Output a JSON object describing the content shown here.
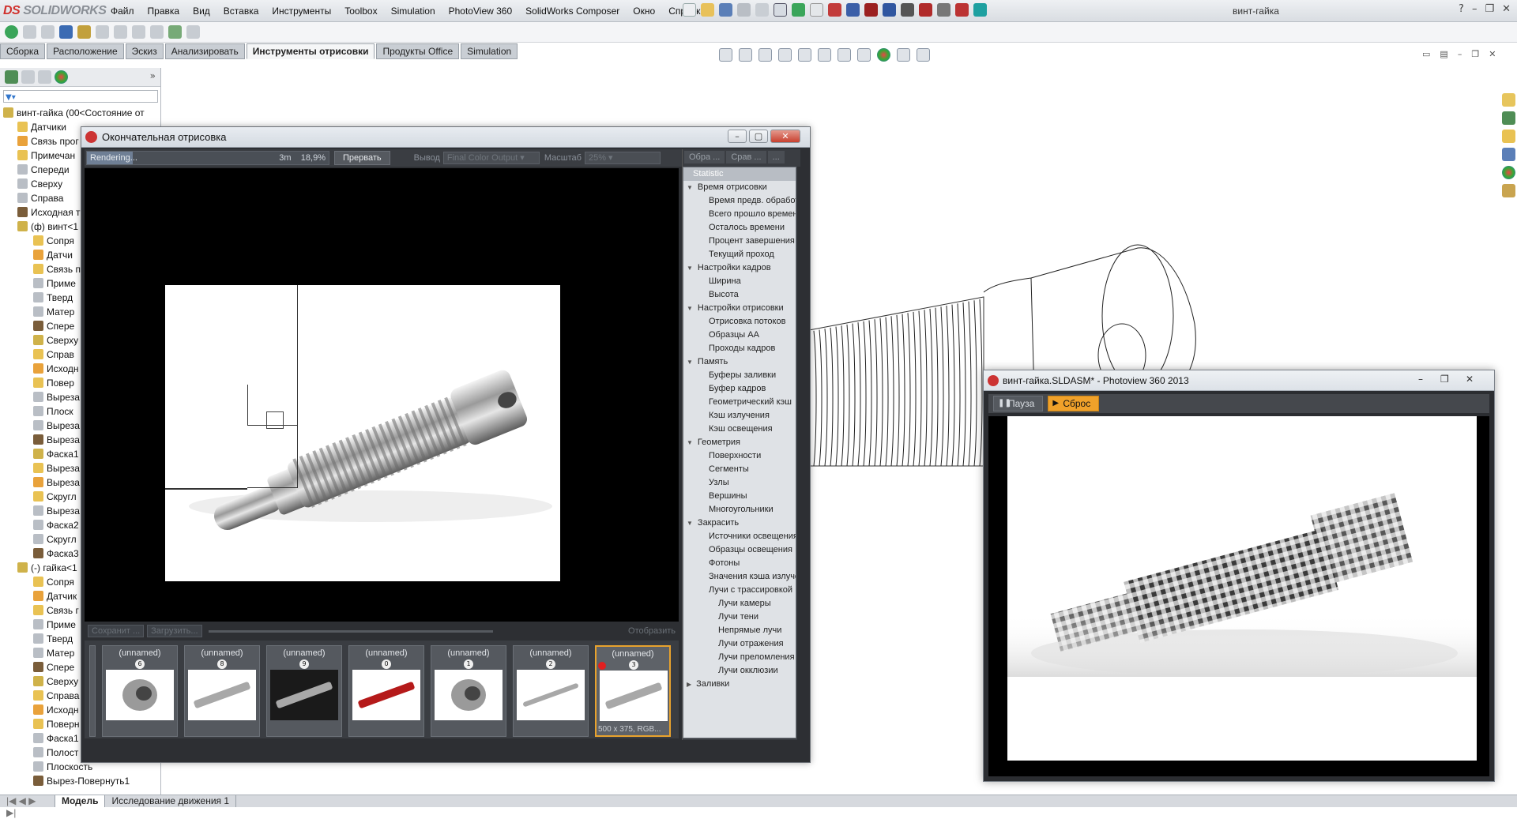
{
  "app": {
    "brand": "SOLIDWORKS",
    "brand_prefix": "DS",
    "title": "винт-гайка"
  },
  "menu": [
    "Файл",
    "Правка",
    "Вид",
    "Вставка",
    "Инструменты",
    "Toolbox",
    "Simulation",
    "PhotoView 360",
    "SolidWorks Composer",
    "Окно",
    "Справка"
  ],
  "command_tabs": [
    {
      "label": "Сборка",
      "active": false
    },
    {
      "label": "Расположение",
      "active": false
    },
    {
      "label": "Эскиз",
      "active": false
    },
    {
      "label": "Анализировать",
      "active": false
    },
    {
      "label": "Инструменты отрисовки",
      "active": true
    },
    {
      "label": "Продукты Office",
      "active": false
    },
    {
      "label": "Simulation",
      "active": false
    }
  ],
  "tree": {
    "root": "винт-гайка  (00<Состояние от",
    "items": [
      "Датчики",
      "Связь прог",
      "Примечан",
      "Спереди",
      "Сверху",
      "Справа",
      "Исходная т",
      "(ф) винт<1",
      "Сопря",
      "Датчи",
      "Связь п",
      "Приме",
      "Тверд",
      "Матер",
      "Спере",
      "Сверху",
      "Справ",
      "Исходн",
      "Повер",
      "Выреза",
      "Плоск",
      "Выреза",
      "Выреза",
      "Фаска1",
      "Выреза",
      "Выреза",
      "Скругл",
      "Выреза",
      "Фаска2",
      "Скругл",
      "Фаска3",
      "(-) гайка<1",
      "Сопря",
      "Датчик",
      "Связь г",
      "Приме",
      "Тверд",
      "Матер",
      "Спере",
      "Сверху",
      "Справа",
      "Исходн",
      "Поверн",
      "Фаска1",
      "Полост",
      "Плоскость",
      "Вырез-Повернуть1"
    ]
  },
  "bottom_tabs": [
    {
      "label": "Модель",
      "active": true
    },
    {
      "label": "Исследование движения 1",
      "active": false
    }
  ],
  "render_window": {
    "title": "Окончательная отрисовка",
    "status": "Rendering...",
    "time_left": "3m",
    "percent_text": "18,9%",
    "progress": 0.189,
    "abort_label": "Прервать",
    "output_label": "Вывод",
    "output_value": "Final Color Output",
    "scale_label": "Масштаб",
    "scale_value": "25%",
    "save_label": "Сохранит ...",
    "load_label": "Загрузить...",
    "show_label": "Отобразить",
    "stat_tabs": [
      "Обра ...",
      "Срав ...",
      "..."
    ],
    "stat_header": "Statistic",
    "stats": [
      {
        "t": "Время отрисовки",
        "k": "g"
      },
      {
        "t": "Время предв. обработки",
        "k": "i"
      },
      {
        "t": "Всего прошло времени",
        "k": "i"
      },
      {
        "t": "Осталось времени",
        "k": "i"
      },
      {
        "t": "Процент завершения",
        "k": "i"
      },
      {
        "t": "Текущий проход",
        "k": "i"
      },
      {
        "t": "Настройки кадров",
        "k": "g"
      },
      {
        "t": "Ширина",
        "k": "i"
      },
      {
        "t": "Высота",
        "k": "i"
      },
      {
        "t": "Настройки отрисовки",
        "k": "g"
      },
      {
        "t": "Отрисовка потоков",
        "k": "i"
      },
      {
        "t": "Образцы AA",
        "k": "i"
      },
      {
        "t": "Проходы кадров",
        "k": "i"
      },
      {
        "t": "Память",
        "k": "g"
      },
      {
        "t": "Буферы заливки",
        "k": "i"
      },
      {
        "t": "Буфер кадров",
        "k": "i"
      },
      {
        "t": "Геометрический кэш",
        "k": "i"
      },
      {
        "t": "Кэш излучения",
        "k": "i"
      },
      {
        "t": "Кэш освещения",
        "k": "i"
      },
      {
        "t": "Геометрия",
        "k": "g"
      },
      {
        "t": "Поверхности",
        "k": "i"
      },
      {
        "t": "Сегменты",
        "k": "i"
      },
      {
        "t": "Узлы",
        "k": "i"
      },
      {
        "t": "Вершины",
        "k": "i"
      },
      {
        "t": "Многоугольники",
        "k": "i"
      },
      {
        "t": "Закрасить",
        "k": "g"
      },
      {
        "t": "Источники освещения",
        "k": "i"
      },
      {
        "t": "Образцы освещения",
        "k": "i"
      },
      {
        "t": "Фотоны",
        "k": "i"
      },
      {
        "t": "Значения кэша излучения",
        "k": "i"
      },
      {
        "t": "Лучи с трассировкой",
        "k": "i"
      },
      {
        "t": "Лучи камеры",
        "k": "i2"
      },
      {
        "t": "Лучи тени",
        "k": "i2"
      },
      {
        "t": "Непрямые лучи",
        "k": "i2"
      },
      {
        "t": "Лучи отражения",
        "k": "i2"
      },
      {
        "t": "Лучи преломления",
        "k": "i2"
      },
      {
        "t": "Лучи окклюзии",
        "k": "i2"
      },
      {
        "t": "Заливки",
        "k": "gc"
      }
    ],
    "thumbs": [
      {
        "name": "(unnamed)",
        "num": "6",
        "pic": "nut",
        "sel": false,
        "meta": ""
      },
      {
        "name": "(unnamed)",
        "num": "8",
        "pic": "screw",
        "sel": false,
        "meta": ""
      },
      {
        "name": "(unnamed)",
        "num": "9",
        "pic": "screw-dark",
        "sel": false,
        "meta": ""
      },
      {
        "name": "(unnamed)",
        "num": "0",
        "pic": "screw-red",
        "sel": false,
        "meta": ""
      },
      {
        "name": "(unnamed)",
        "num": "1",
        "pic": "nut",
        "sel": false,
        "meta": ""
      },
      {
        "name": "(unnamed)",
        "num": "2",
        "pic": "screw-thin",
        "sel": false,
        "meta": ""
      },
      {
        "name": "(unnamed)",
        "num": "3",
        "pic": "screw",
        "sel": true,
        "meta": "500 x 375, RGB..."
      }
    ]
  },
  "photoview": {
    "title": "винт-гайка.SLDASM* - Photoview 360 2013",
    "pause_label": "Пауза",
    "reset_label": "Сброс"
  },
  "colors": {
    "accent": "#f0a12a",
    "brand": "#d0312d",
    "progress": "#6f7f95"
  }
}
